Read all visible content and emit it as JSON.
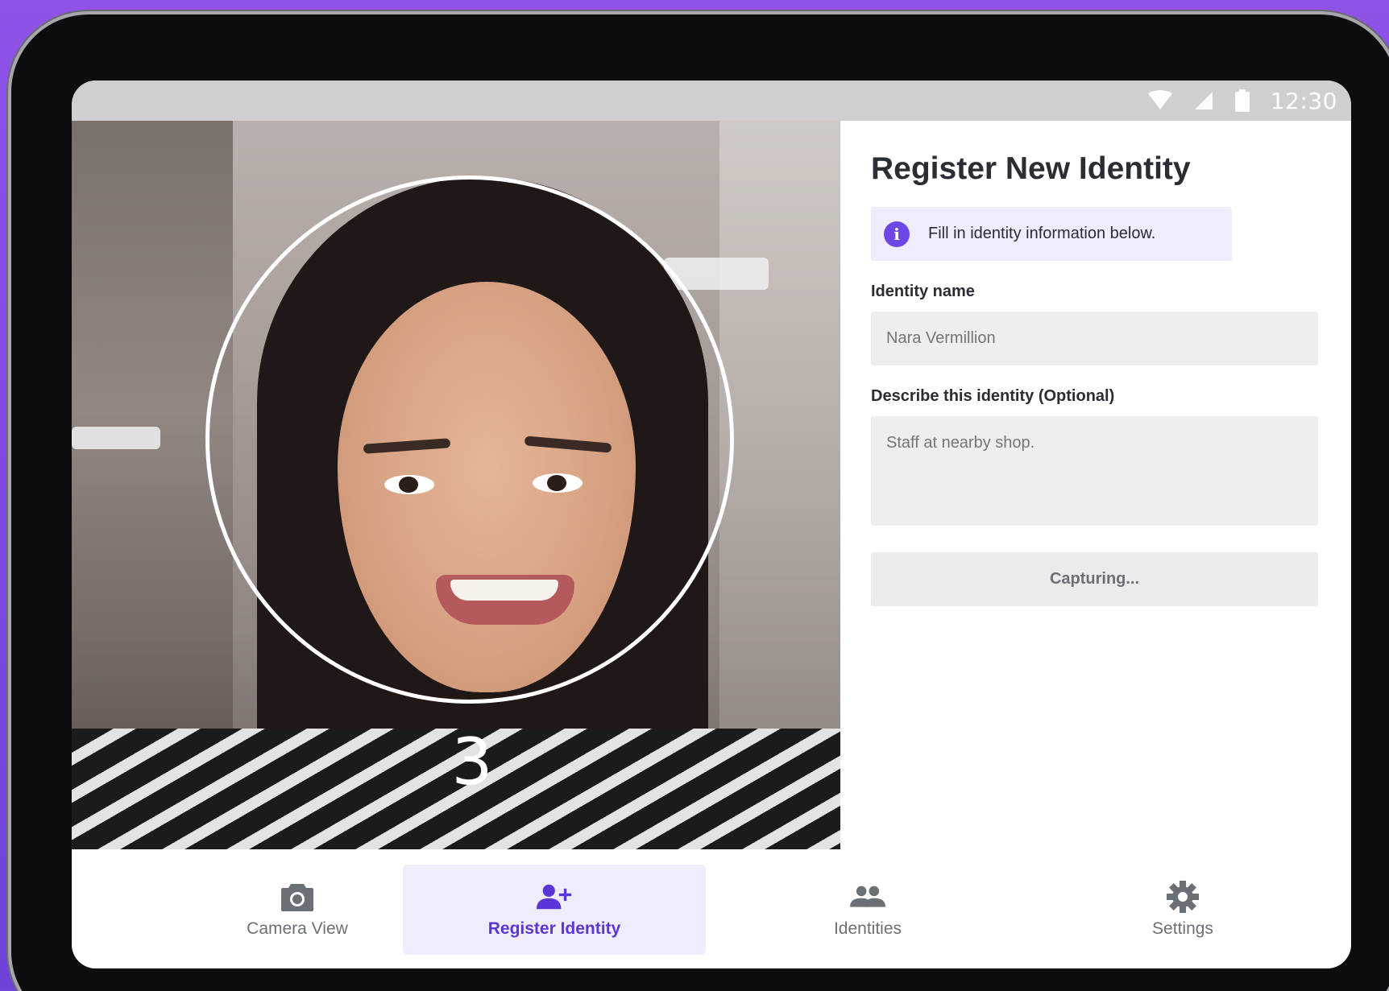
{
  "status_bar": {
    "time": "12:30"
  },
  "camera": {
    "countdown": "3"
  },
  "form": {
    "title": "Register New Identity",
    "info_text": "Fill in identity information below.",
    "name_label": "Identity name",
    "name_placeholder": "Nara Vermillion",
    "description_label": "Describe this identity (Optional)",
    "description_placeholder": "Staff at nearby shop.",
    "button_label": "Capturing..."
  },
  "nav": {
    "items": [
      {
        "label": "Camera View",
        "icon": "camera-icon",
        "active": false
      },
      {
        "label": "Register Identity",
        "icon": "person-add-icon",
        "active": true
      },
      {
        "label": "Identities",
        "icon": "people-icon",
        "active": false
      },
      {
        "label": "Settings",
        "icon": "gear-icon",
        "active": false
      }
    ]
  },
  "colors": {
    "accent": "#6f46e6",
    "accent_bg": "#efecfd",
    "background": "#8f53e6"
  }
}
